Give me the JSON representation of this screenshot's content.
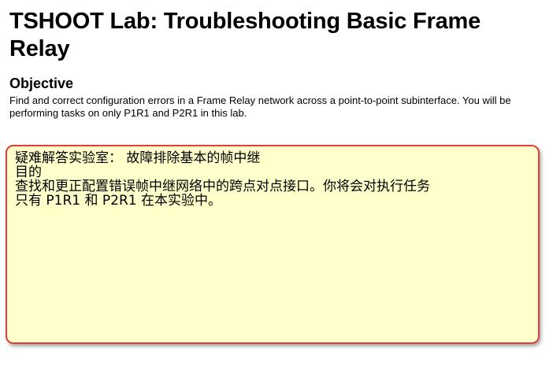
{
  "page": {
    "title": "TSHOOT Lab: Troubleshooting Basic Frame Relay",
    "objective_heading": "Objective",
    "objective_text": "Find and correct configuration errors in a Frame Relay network across a point-to-point subinterface. You will be performing tasks on only P1R1 and P2R1 in this lab."
  },
  "translation_box": {
    "background_color": "#ffffcc",
    "border_color": "#e0403a",
    "lines": [
      "疑难解答实验室： 故障排除基本的帧中继",
      "目的",
      "查找和更正配置错误帧中继网络中的跨点对点接口。你将会对执行任务",
      "只有 P1R1 和 P2R1 在本实验中。"
    ]
  }
}
